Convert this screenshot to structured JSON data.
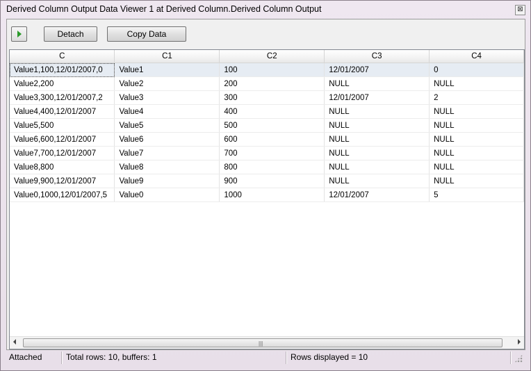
{
  "window": {
    "title": "Derived Column Output Data Viewer 1 at Derived Column.Derived Column Output",
    "close_glyph": "⊠"
  },
  "toolbar": {
    "run_icon": "play-icon",
    "detach_label": "Detach",
    "copy_label": "Copy Data"
  },
  "grid": {
    "columns": [
      "C",
      "C1",
      "C2",
      "C3",
      "C4"
    ],
    "rows": [
      [
        "Value1,100,12/01/2007,0",
        "Value1",
        "100",
        "12/01/2007",
        "0"
      ],
      [
        "Value2,200",
        "Value2",
        "200",
        "NULL",
        "NULL"
      ],
      [
        "Value3,300,12/01/2007,2",
        "Value3",
        "300",
        "12/01/2007",
        "2"
      ],
      [
        "Value4,400,12/01/2007",
        "Value4",
        "400",
        "NULL",
        "NULL"
      ],
      [
        "Value5,500",
        "Value5",
        "500",
        "NULL",
        "NULL"
      ],
      [
        "Value6,600,12/01/2007",
        "Value6",
        "600",
        "NULL",
        "NULL"
      ],
      [
        "Value7,700,12/01/2007",
        "Value7",
        "700",
        "NULL",
        "NULL"
      ],
      [
        "Value8,800",
        "Value8",
        "800",
        "NULL",
        "NULL"
      ],
      [
        "Value9,900,12/01/2007",
        "Value9",
        "900",
        "NULL",
        "NULL"
      ],
      [
        "Value0,1000,12/01/2007,5",
        "Value0",
        "1000",
        "12/01/2007",
        "5"
      ]
    ],
    "selected_row": 0,
    "scrollbar_grip": "|||"
  },
  "status": {
    "state": "Attached",
    "totals": "Total rows: 10, buffers: 1",
    "displayed": "Rows displayed = 10"
  }
}
